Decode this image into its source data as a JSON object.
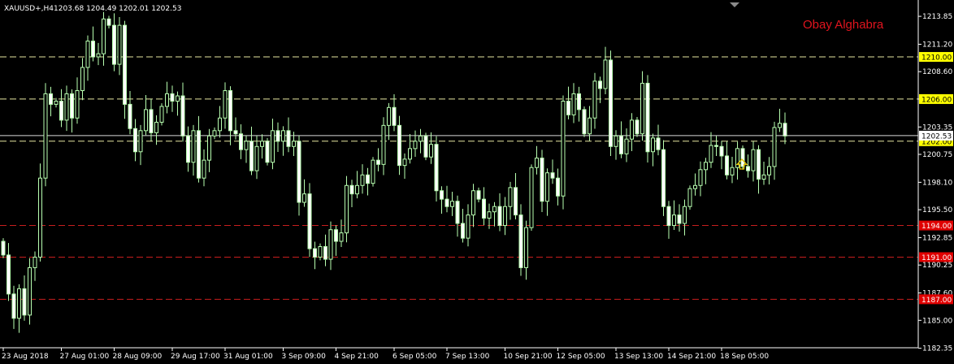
{
  "header": {
    "symbol": "XAUUSD+,H4",
    "ohlc": "1203.68 1204.49 1202.01 1202.53"
  },
  "signature": {
    "text": "Obay Alghabra",
    "color": "#e0141e"
  },
  "colors": {
    "background": "#000000",
    "candle": "#b8ffb0",
    "candle_bull_body": "#000000",
    "candle_bear_body": "#ffffff",
    "resistance": "#e6e6a0",
    "support": "#c81e1e",
    "price_line": "#d9d9d9",
    "arrow": "#e5c400",
    "text": "#ffffff"
  },
  "chart_data": {
    "type": "candlestick",
    "y_range": [
      1182.4,
      1215.4
    ],
    "y_ticks": [
      "1213.85",
      "1211.20",
      "1208.60",
      "1206.00",
      "1203.35",
      "1200.75",
      "1198.10",
      "1195.50",
      "1192.85",
      "1190.25",
      "1187.60",
      "1185.00",
      "1182.35"
    ],
    "x_ticks": [
      {
        "label": "23 Aug 2018",
        "index": 0
      },
      {
        "label": "27 Aug 01:00",
        "index": 11
      },
      {
        "label": "28 Aug 09:00",
        "index": 21
      },
      {
        "label": "29 Aug 17:00",
        "index": 32
      },
      {
        "label": "31 Aug 01:00",
        "index": 42
      },
      {
        "label": "3 Sep 09:00",
        "index": 53
      },
      {
        "label": "4 Sep 21:00",
        "index": 63
      },
      {
        "label": "6 Sep 05:00",
        "index": 74
      },
      {
        "label": "7 Sep 13:00",
        "index": 84
      },
      {
        "label": "10 Sep 21:00",
        "index": 95
      },
      {
        "label": "12 Sep 05:00",
        "index": 105
      },
      {
        "label": "13 Sep 13:00",
        "index": 116
      },
      {
        "label": "14 Sep 21:00",
        "index": 126
      },
      {
        "label": "18 Sep 05:00",
        "index": 136
      }
    ],
    "horizontal_lines": [
      {
        "price": 1210.0,
        "label": "1210.00",
        "kind": "resistance"
      },
      {
        "price": 1206.0,
        "label": "1206.00",
        "kind": "resistance"
      },
      {
        "price": 1202.0,
        "label": "1202.00",
        "kind": "resistance"
      },
      {
        "price": 1194.0,
        "label": "1194.00",
        "kind": "support"
      },
      {
        "price": 1191.0,
        "label": "1191.00",
        "kind": "support"
      },
      {
        "price": 1187.0,
        "label": "1187.00",
        "kind": "support"
      }
    ],
    "current_price": {
      "price": 1202.53,
      "label": "1202.53"
    },
    "candles": []
  }
}
